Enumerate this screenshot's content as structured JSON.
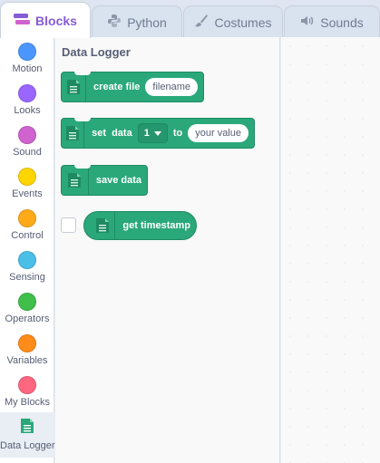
{
  "tabs": [
    {
      "label": "Blocks",
      "icon": "blocks-icon",
      "active": true
    },
    {
      "label": "Python",
      "icon": "python-icon",
      "active": false
    },
    {
      "label": "Costumes",
      "icon": "brush-icon",
      "active": false
    },
    {
      "label": "Sounds",
      "icon": "speaker-icon",
      "active": false
    }
  ],
  "categories": [
    {
      "label": "Motion",
      "color": "#4c97ff"
    },
    {
      "label": "Looks",
      "color": "#9966ff"
    },
    {
      "label": "Sound",
      "color": "#cf63cf"
    },
    {
      "label": "Events",
      "color": "#ffd500"
    },
    {
      "label": "Control",
      "color": "#ffab19"
    },
    {
      "label": "Sensing",
      "color": "#4cbfe6"
    },
    {
      "label": "Operators",
      "color": "#40bf4a"
    },
    {
      "label": "Variables",
      "color": "#ff8c1a"
    },
    {
      "label": "My Blocks",
      "color": "#ff6680"
    },
    {
      "label": "Data Logger",
      "icon": "spreadsheet-icon",
      "selected": true
    }
  ],
  "flyout": {
    "title": "Data Logger",
    "blocks": {
      "create_file": {
        "text": "create file",
        "input": "filename"
      },
      "set_data": {
        "text_1": "set  data",
        "dropdown": "1",
        "text_2": "to",
        "input": "your value"
      },
      "save_data": {
        "text": "save data"
      },
      "get_timestamp": {
        "text": "get timestamp"
      }
    }
  },
  "colors": {
    "extension_green": "#2aa87a",
    "accent_purple": "#855cd6"
  }
}
